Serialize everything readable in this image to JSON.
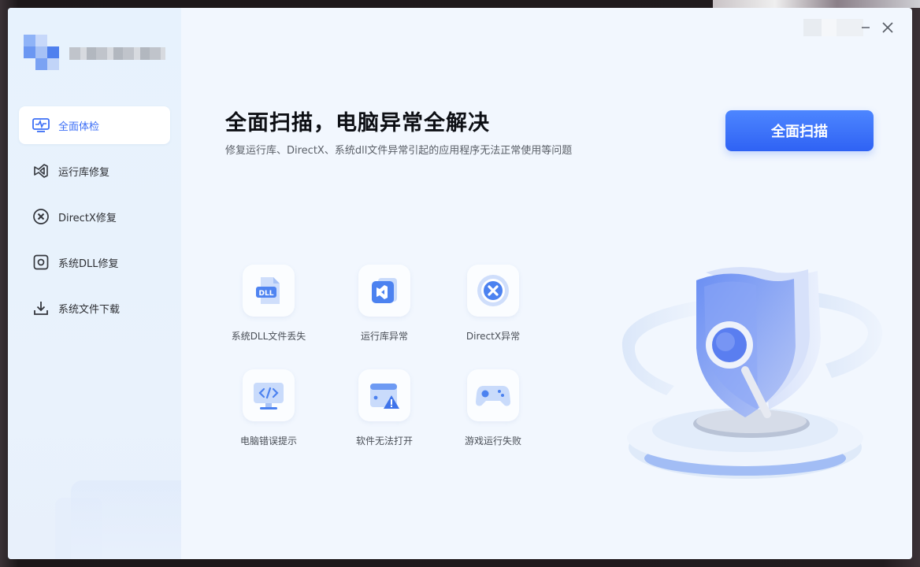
{
  "sidebar": {
    "items": [
      {
        "label": "全面体检",
        "icon": "monitor-pulse-icon",
        "active": true
      },
      {
        "label": "运行库修复",
        "icon": "visual-studio-icon",
        "active": false
      },
      {
        "label": "DirectX修复",
        "icon": "directx-circle-icon",
        "active": false
      },
      {
        "label": "系统DLL修复",
        "icon": "dll-gear-icon",
        "active": false
      },
      {
        "label": "系统文件下载",
        "icon": "download-icon",
        "active": false
      }
    ]
  },
  "main": {
    "headline": "全面扫描，电脑异常全解决",
    "subline": "修复运行库、DirectX、系统dll文件异常引起的应用程序无法正常使用等问题",
    "scan_button": "全面扫描",
    "features": [
      {
        "label": "系统DLL文件丢失",
        "icon": "dll-file-icon"
      },
      {
        "label": "运行库异常",
        "icon": "runtime-icon"
      },
      {
        "label": "DirectX异常",
        "icon": "directx-icon"
      },
      {
        "label": "电脑错误提示",
        "icon": "code-monitor-icon"
      },
      {
        "label": "软件无法打开",
        "icon": "window-warning-icon"
      },
      {
        "label": "游戏运行失败",
        "icon": "gamepad-icon"
      }
    ]
  },
  "colors": {
    "accent": "#3b6ef6",
    "window_bg": "#f2f7fe",
    "sidebar_bg": "#e7f2fd"
  }
}
